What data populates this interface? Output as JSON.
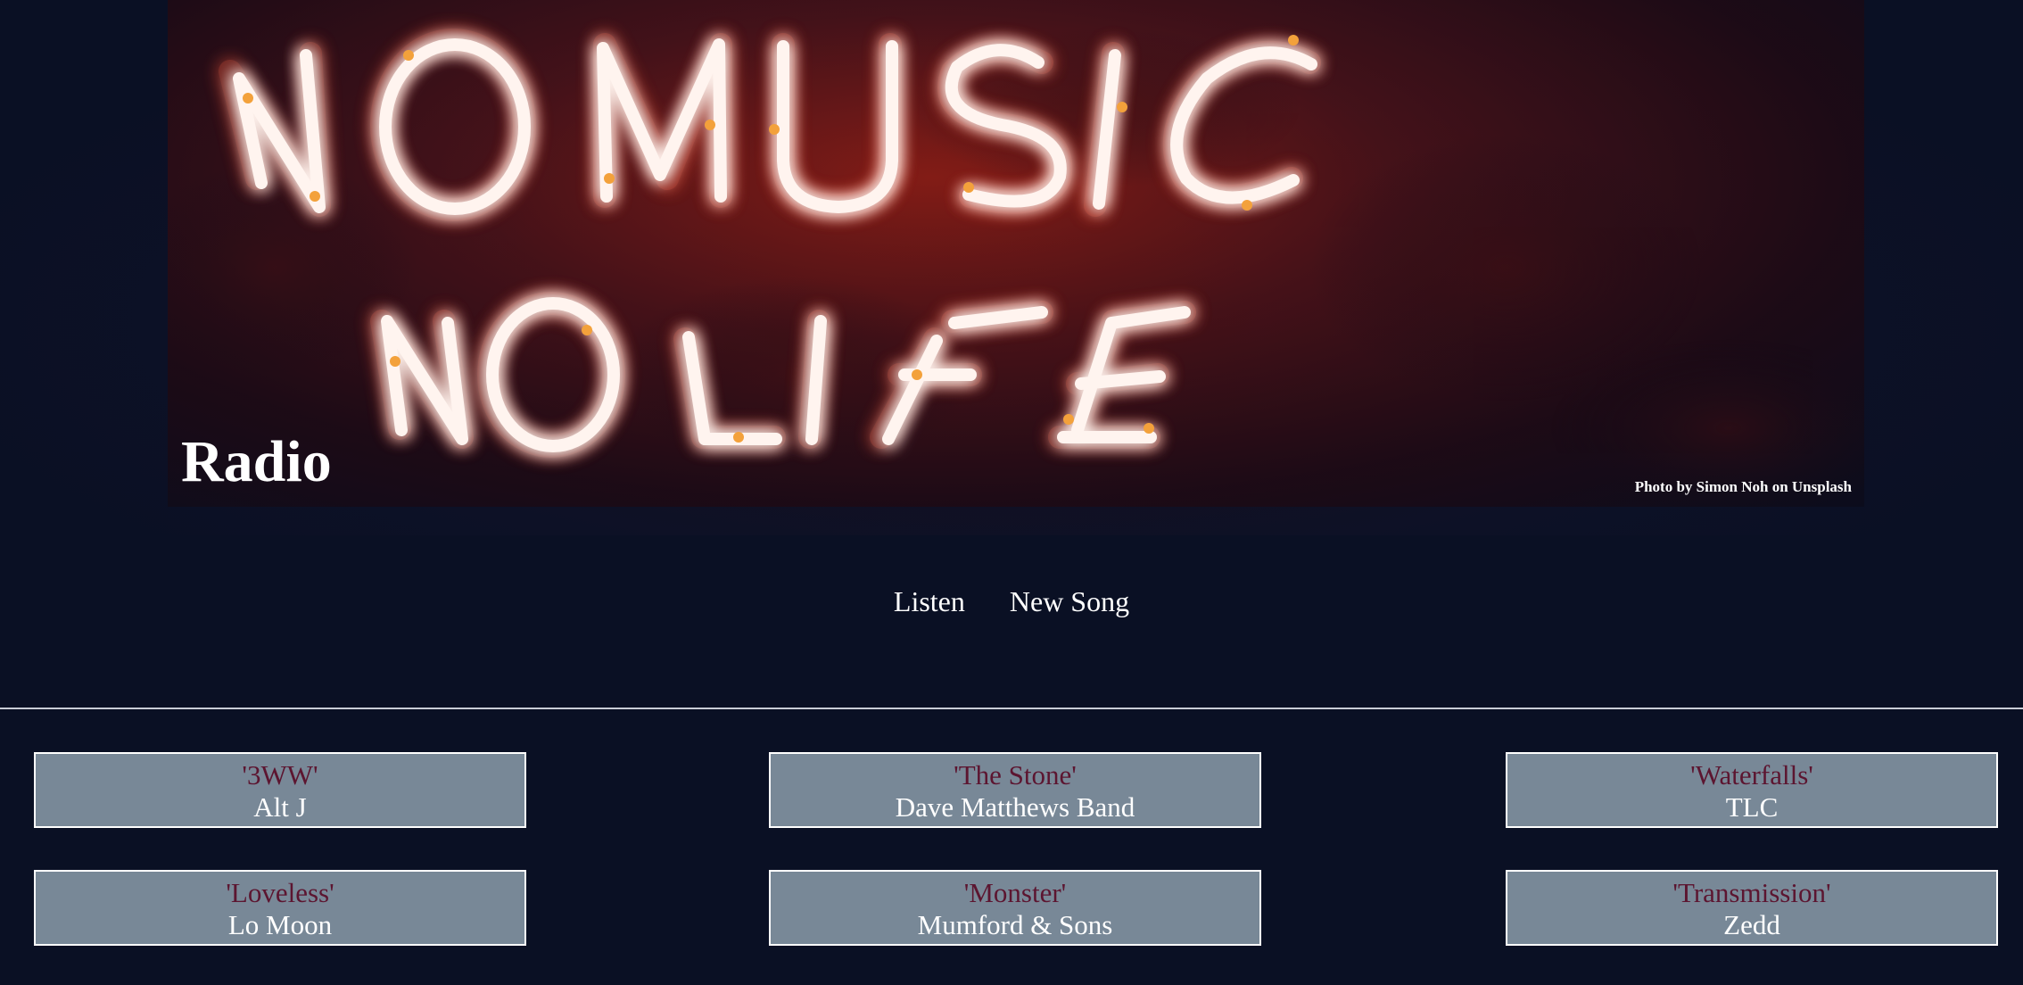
{
  "header": {
    "title": "Radio",
    "photo_credit": "Photo by Simon Noh on Unsplash",
    "hero_sign_text": [
      "NO MUSIC",
      "NO LIFE"
    ]
  },
  "nav": {
    "items": [
      {
        "label": "Listen"
      },
      {
        "label": "New Song"
      }
    ]
  },
  "songs": [
    {
      "title": "'3WW'",
      "artist": "Alt J"
    },
    {
      "title": "'The Stone'",
      "artist": "Dave Matthews Band"
    },
    {
      "title": "'Waterfalls'",
      "artist": "TLC"
    },
    {
      "title": "'Loveless'",
      "artist": "Lo Moon"
    },
    {
      "title": "'Monster'",
      "artist": "Mumford & Sons"
    },
    {
      "title": "'Transmission'",
      "artist": "Zedd"
    }
  ],
  "colors": {
    "page_background": "#0a1024",
    "card_background": "#788897",
    "song_title_color": "#5c1530",
    "neon": "#fff4ef",
    "neon_glow": "#ff3b1f"
  }
}
